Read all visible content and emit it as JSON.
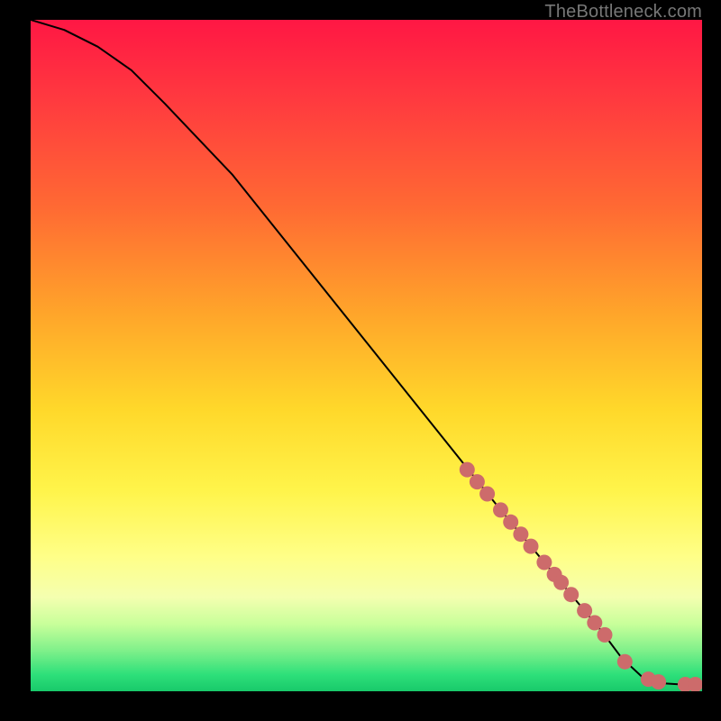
{
  "watermark": "TheBottleneck.com",
  "chart_data": {
    "type": "line",
    "title": "",
    "xlabel": "",
    "ylabel": "",
    "xlim": [
      0,
      100
    ],
    "ylim": [
      0,
      100
    ],
    "curve": [
      {
        "x": 0,
        "y": 100
      },
      {
        "x": 5,
        "y": 98.5
      },
      {
        "x": 10,
        "y": 96
      },
      {
        "x": 15,
        "y": 92.5
      },
      {
        "x": 20,
        "y": 87.5
      },
      {
        "x": 30,
        "y": 77
      },
      {
        "x": 40,
        "y": 64.5
      },
      {
        "x": 50,
        "y": 52
      },
      {
        "x": 60,
        "y": 39.5
      },
      {
        "x": 70,
        "y": 27
      },
      {
        "x": 80,
        "y": 15
      },
      {
        "x": 85,
        "y": 9
      },
      {
        "x": 88,
        "y": 5
      },
      {
        "x": 91,
        "y": 2.2
      },
      {
        "x": 94,
        "y": 1.2
      },
      {
        "x": 97,
        "y": 1.0
      },
      {
        "x": 100,
        "y": 1.0
      }
    ],
    "markers": [
      {
        "x": 65,
        "y": 33
      },
      {
        "x": 66.5,
        "y": 31.2
      },
      {
        "x": 68,
        "y": 29.4
      },
      {
        "x": 70,
        "y": 27
      },
      {
        "x": 71.5,
        "y": 25.2
      },
      {
        "x": 73,
        "y": 23.4
      },
      {
        "x": 74.5,
        "y": 21.6
      },
      {
        "x": 76.5,
        "y": 19.2
      },
      {
        "x": 78,
        "y": 17.4
      },
      {
        "x": 79,
        "y": 16.2
      },
      {
        "x": 80.5,
        "y": 14.4
      },
      {
        "x": 82.5,
        "y": 12
      },
      {
        "x": 84,
        "y": 10.2
      },
      {
        "x": 85.5,
        "y": 8.4
      },
      {
        "x": 88.5,
        "y": 4.4
      },
      {
        "x": 92,
        "y": 1.8
      },
      {
        "x": 93.5,
        "y": 1.4
      },
      {
        "x": 97.5,
        "y": 1.0
      },
      {
        "x": 99,
        "y": 1.0
      }
    ],
    "marker_color": "#cd6b6b",
    "marker_radius_px": 8.5,
    "line_color": "#000000",
    "gradient_stops": [
      {
        "pos": 0.0,
        "color": "#ff1744"
      },
      {
        "pos": 0.28,
        "color": "#ff6a33"
      },
      {
        "pos": 0.58,
        "color": "#ffd82a"
      },
      {
        "pos": 0.8,
        "color": "#ffff88"
      },
      {
        "pos": 0.94,
        "color": "#7ef08a"
      },
      {
        "pos": 1.0,
        "color": "#18c96a"
      }
    ]
  }
}
